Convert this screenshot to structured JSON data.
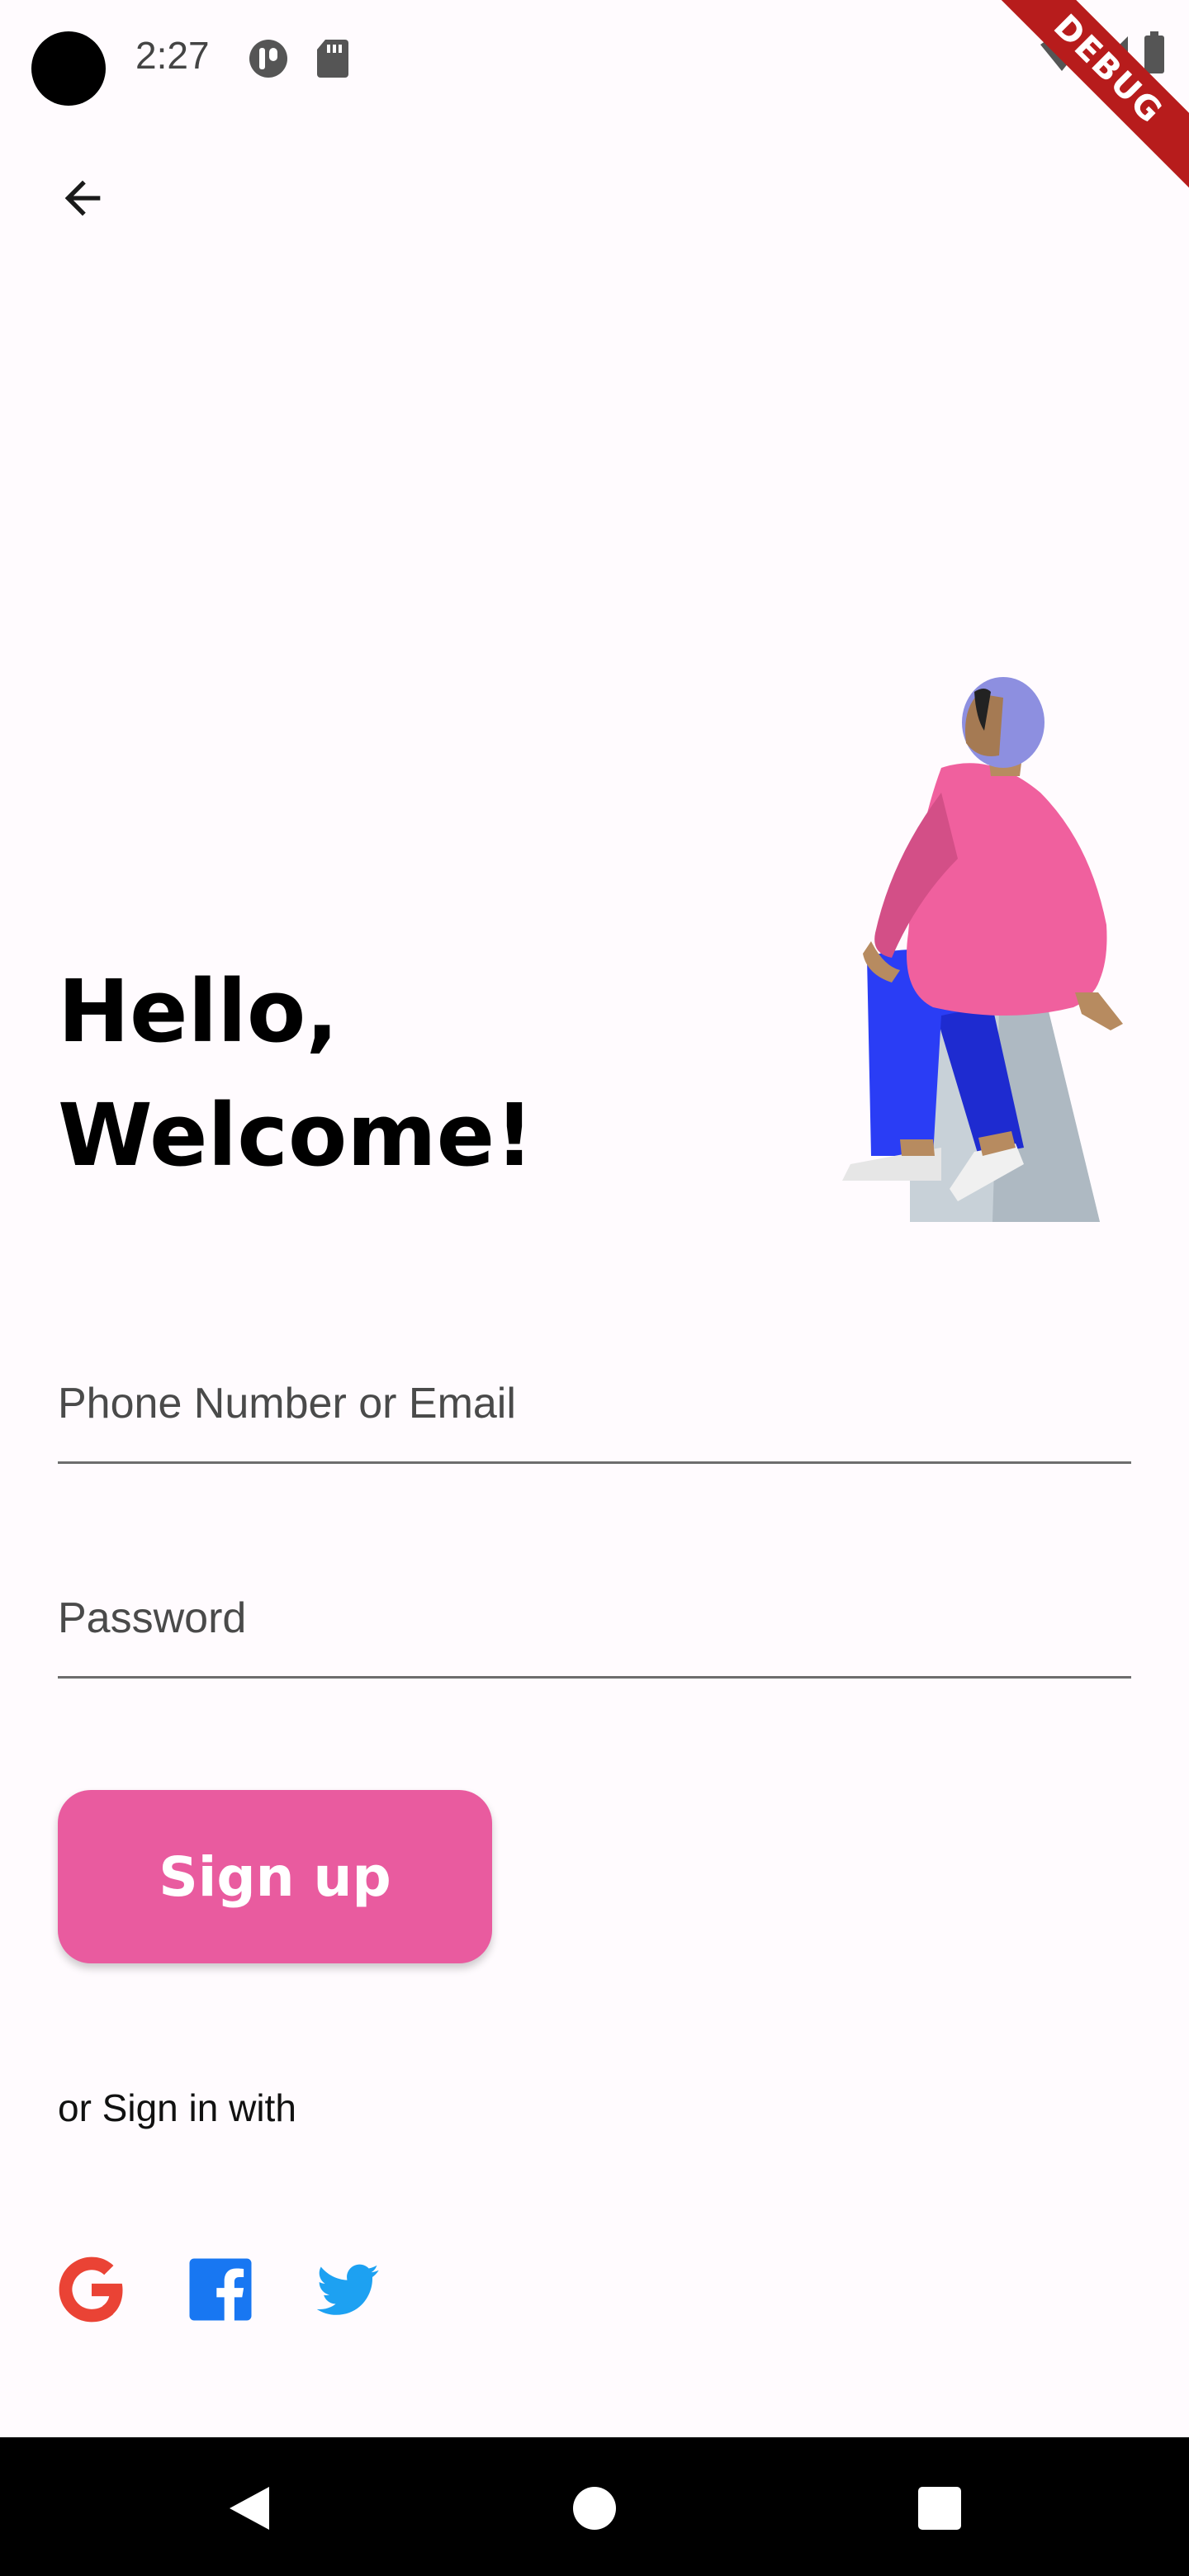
{
  "status_bar": {
    "time": "2:27",
    "debug_label": "DEBUG"
  },
  "header": {
    "back_icon": "arrow-back-icon"
  },
  "greeting": {
    "line1": "Hello,",
    "line2": "Welcome!"
  },
  "form": {
    "identifier_placeholder": "Phone Number or Email",
    "password_placeholder": "Password",
    "signup_label": "Sign up"
  },
  "social": {
    "caption": "or Sign in with",
    "providers": [
      "google-icon",
      "facebook-icon",
      "twitter-icon"
    ]
  },
  "colors": {
    "accent": "#e95b9f",
    "background": "#fffbfe",
    "google": "#ea4335",
    "facebook": "#1877f2",
    "twitter": "#1da1f2"
  }
}
